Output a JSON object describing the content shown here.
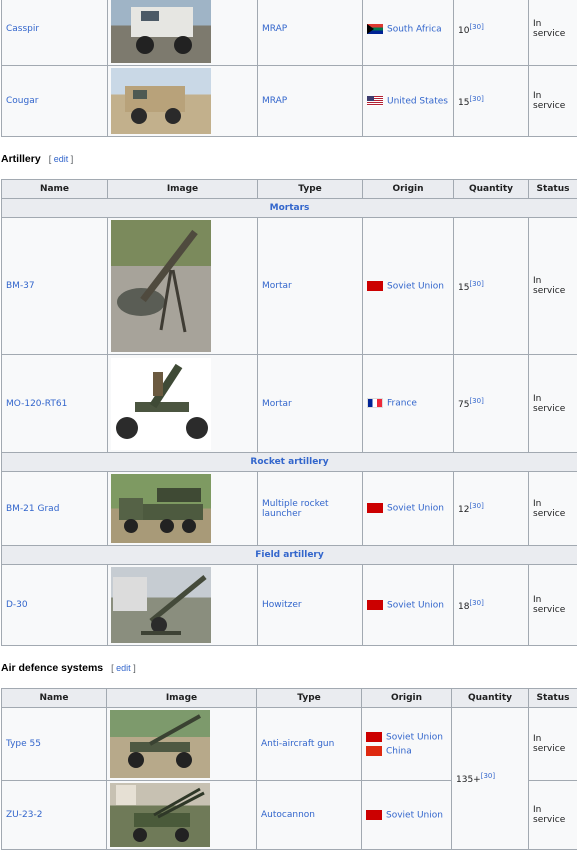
{
  "top_table": {
    "rows": [
      {
        "name": "Casspir",
        "type": "MRAP",
        "origin": "South Africa",
        "flag": "za",
        "quantity": "10",
        "ref": "[30]",
        "status": "In service",
        "image_icon": "casspir-vehicle-photo"
      },
      {
        "name": "Cougar",
        "type": "MRAP",
        "origin": "United States",
        "flag": "us",
        "quantity": "15",
        "ref": "[30]",
        "status": "In service",
        "image_icon": "cougar-vehicle-photo"
      }
    ]
  },
  "artillery": {
    "heading": "Artillery",
    "edit_open": "[",
    "edit_label": "edit",
    "edit_close": "]",
    "columns": [
      "Name",
      "Image",
      "Type",
      "Origin",
      "Quantity",
      "Status"
    ],
    "groups": {
      "mortars": "Mortars",
      "rocket": "Rocket artillery",
      "field": "Field artillery"
    },
    "rows": [
      {
        "name": "BM-37",
        "type": "Mortar",
        "origin": "Soviet Union",
        "flag": "su",
        "quantity": "15",
        "ref": "[30]",
        "status": "In service"
      },
      {
        "name": "MO-120-RT61",
        "type": "Mortar",
        "origin": "France",
        "flag": "fr",
        "quantity": "75",
        "ref": "[30]",
        "status": "In service"
      },
      {
        "name": "BM-21 Grad",
        "type": "Multiple rocket launcher",
        "origin": "Soviet Union",
        "flag": "su",
        "quantity": "12",
        "ref": "[30]",
        "status": "In service"
      },
      {
        "name": "D-30",
        "type": "Howitzer",
        "origin": "Soviet Union",
        "flag": "su",
        "quantity": "18",
        "ref": "[30]",
        "status": "In service"
      }
    ]
  },
  "air_defence": {
    "heading": "Air defence systems",
    "edit_open": "[",
    "edit_label": "edit",
    "edit_close": "]",
    "columns": [
      "Name",
      "Image",
      "Type",
      "Origin",
      "Quantity",
      "Status"
    ],
    "shared_quantity": "135+",
    "shared_ref": "[30]",
    "rows": [
      {
        "name": "Type 55",
        "type": "Anti-aircraft gun",
        "origin": "Soviet Union",
        "origin2": "China",
        "status": "In service"
      },
      {
        "name": "ZU-23-2",
        "type": "Autocannon",
        "origin": "Soviet Union",
        "status": "In service"
      }
    ]
  },
  "colors": {
    "link": "#3366cc",
    "header_bg": "#eaecf0",
    "border": "#a2a9b1"
  }
}
